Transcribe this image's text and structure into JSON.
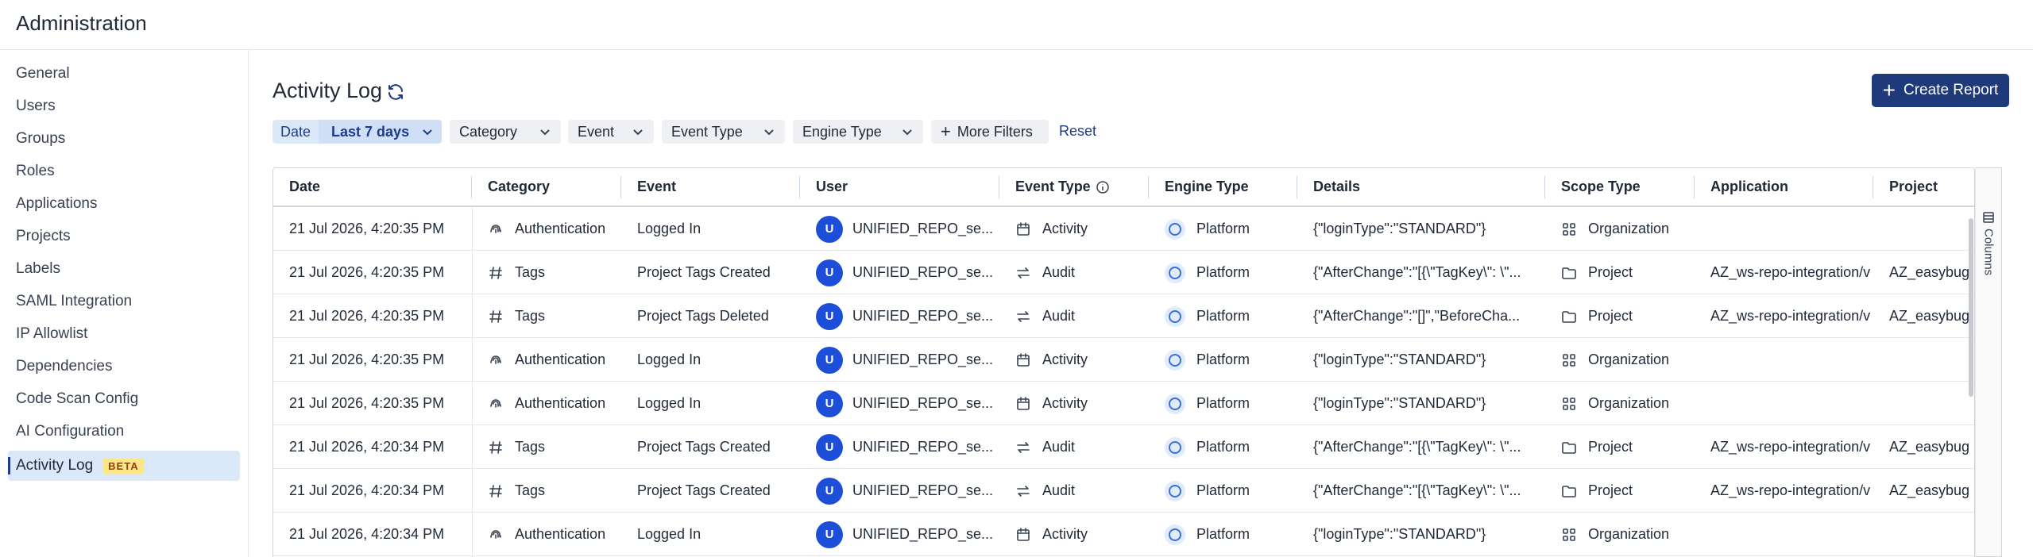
{
  "app": {
    "title": "Administration"
  },
  "sidebar": {
    "items": [
      {
        "label": "General"
      },
      {
        "label": "Users"
      },
      {
        "label": "Groups"
      },
      {
        "label": "Roles"
      },
      {
        "label": "Applications"
      },
      {
        "label": "Projects"
      },
      {
        "label": "Labels"
      },
      {
        "label": "SAML Integration"
      },
      {
        "label": "IP Allowlist"
      },
      {
        "label": "Dependencies"
      },
      {
        "label": "Code Scan Config"
      },
      {
        "label": "AI Configuration"
      },
      {
        "label": "Activity Log",
        "badge": "BETA",
        "active": true
      }
    ]
  },
  "page": {
    "title": "Activity Log",
    "create_label": "Create Report",
    "create_icon": "plus-icon",
    "refresh_icon": "refresh-icon"
  },
  "filters": {
    "date_label": "Date",
    "date_value": "Last 7 days",
    "category": "Category",
    "event": "Event",
    "event_type": "Event Type",
    "engine_type": "Engine Type",
    "more": "More Filters",
    "reset": "Reset"
  },
  "table": {
    "columns": [
      "Date",
      "Category",
      "Event",
      "User",
      "Event Type",
      "Engine Type",
      "Details",
      "Scope Type",
      "Application",
      "Project"
    ],
    "rows": [
      {
        "date": "21 Jul 2026, 4:20:35 PM",
        "category": "Authentication",
        "category_icon": "fingerprint-icon",
        "event": "Logged In",
        "user_initial": "U",
        "user": "UNIFIED_REPO_se...",
        "event_type": "Activity",
        "event_type_icon": "calendar-icon",
        "engine": "Platform",
        "details": "{\"loginType\":\"STANDARD\"}",
        "scope": "Organization",
        "scope_icon": "org-icon",
        "application": "",
        "project": ""
      },
      {
        "date": "21 Jul 2026, 4:20:35 PM",
        "category": "Tags",
        "category_icon": "hash-icon",
        "event": "Project Tags Created",
        "user_initial": "U",
        "user": "UNIFIED_REPO_se...",
        "event_type": "Audit",
        "event_type_icon": "swap-icon",
        "engine": "Platform",
        "details": "{\"AfterChange\":\"[{\\\"TagKey\\\": \\\"...",
        "scope": "Project",
        "scope_icon": "folder-icon",
        "application": "AZ_ws-repo-integration/v",
        "project": "AZ_easybug"
      },
      {
        "date": "21 Jul 2026, 4:20:35 PM",
        "category": "Tags",
        "category_icon": "hash-icon",
        "event": "Project Tags Deleted",
        "user_initial": "U",
        "user": "UNIFIED_REPO_se...",
        "event_type": "Audit",
        "event_type_icon": "swap-icon",
        "engine": "Platform",
        "details": "{\"AfterChange\":\"[]\",\"BeforeCha...",
        "scope": "Project",
        "scope_icon": "folder-icon",
        "application": "AZ_ws-repo-integration/v",
        "project": "AZ_easybug"
      },
      {
        "date": "21 Jul 2026, 4:20:35 PM",
        "category": "Authentication",
        "category_icon": "fingerprint-icon",
        "event": "Logged In",
        "user_initial": "U",
        "user": "UNIFIED_REPO_se...",
        "event_type": "Activity",
        "event_type_icon": "calendar-icon",
        "engine": "Platform",
        "details": "{\"loginType\":\"STANDARD\"}",
        "scope": "Organization",
        "scope_icon": "org-icon",
        "application": "",
        "project": ""
      },
      {
        "date": "21 Jul 2026, 4:20:35 PM",
        "category": "Authentication",
        "category_icon": "fingerprint-icon",
        "event": "Logged In",
        "user_initial": "U",
        "user": "UNIFIED_REPO_se...",
        "event_type": "Activity",
        "event_type_icon": "calendar-icon",
        "engine": "Platform",
        "details": "{\"loginType\":\"STANDARD\"}",
        "scope": "Organization",
        "scope_icon": "org-icon",
        "application": "",
        "project": ""
      },
      {
        "date": "21 Jul 2026, 4:20:34 PM",
        "category": "Tags",
        "category_icon": "hash-icon",
        "event": "Project Tags Created",
        "user_initial": "U",
        "user": "UNIFIED_REPO_se...",
        "event_type": "Audit",
        "event_type_icon": "swap-icon",
        "engine": "Platform",
        "details": "{\"AfterChange\":\"[{\\\"TagKey\\\": \\\"...",
        "scope": "Project",
        "scope_icon": "folder-icon",
        "application": "AZ_ws-repo-integration/v",
        "project": "AZ_easybug"
      },
      {
        "date": "21 Jul 2026, 4:20:34 PM",
        "category": "Tags",
        "category_icon": "hash-icon",
        "event": "Project Tags Created",
        "user_initial": "U",
        "user": "UNIFIED_REPO_se...",
        "event_type": "Audit",
        "event_type_icon": "swap-icon",
        "engine": "Platform",
        "details": "{\"AfterChange\":\"[{\\\"TagKey\\\": \\\"...",
        "scope": "Project",
        "scope_icon": "folder-icon",
        "application": "AZ_ws-repo-integration/v",
        "project": "AZ_easybug"
      },
      {
        "date": "21 Jul 2026, 4:20:34 PM",
        "category": "Authentication",
        "category_icon": "fingerprint-icon",
        "event": "Logged In",
        "user_initial": "U",
        "user": "UNIFIED_REPO_se...",
        "event_type": "Activity",
        "event_type_icon": "calendar-icon",
        "engine": "Platform",
        "details": "{\"loginType\":\"STANDARD\"}",
        "scope": "Organization",
        "scope_icon": "org-icon",
        "application": "",
        "project": ""
      }
    ]
  },
  "column_panel": {
    "label": "Columns",
    "icon": "columns-icon"
  },
  "colors": {
    "primary": "#1e3a7a",
    "accent": "#1d4ed8",
    "active_bg": "#dbe8f8",
    "beta_bg": "#fde68a"
  }
}
